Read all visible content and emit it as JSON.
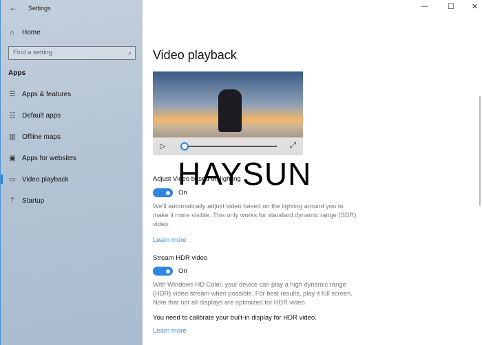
{
  "window": {
    "title": "Settings",
    "controls": [
      "minimize",
      "maximize",
      "close"
    ]
  },
  "sidebar": {
    "home": "Home",
    "search_placeholder": "Find a setting",
    "section": "Apps",
    "items": [
      {
        "label": "Apps & features",
        "icon": "list-icon"
      },
      {
        "label": "Default apps",
        "icon": "default-apps-icon"
      },
      {
        "label": "Offline maps",
        "icon": "map-icon"
      },
      {
        "label": "Apps for websites",
        "icon": "web-app-icon"
      },
      {
        "label": "Video playback",
        "icon": "video-icon",
        "selected": true
      },
      {
        "label": "Startup",
        "icon": "startup-icon"
      }
    ]
  },
  "main": {
    "title": "Video playback",
    "video": {
      "progress": 0
    },
    "adjust": {
      "label": "Adjust Video based on lighting",
      "state": "On",
      "description": "We'll automatically adjust video based on the lighting around you to make it more visible. This only works for standard dynamic range (SDR) video.",
      "link": "Learn more"
    },
    "hdr": {
      "label": "Stream HDR video",
      "state": "On",
      "description": "With Windows HD Color, your device can play a high dynamic range (HDR) video stream when possible. For best results, play it full screen. Note that not all displays are optimized for HDR video.",
      "note": "You need to calibrate your built-in display for HDR video.",
      "link": "Learn more"
    }
  },
  "watermark": "HAYSUN",
  "colors": {
    "accent": "#2f86e0",
    "link": "#3a8be0"
  }
}
